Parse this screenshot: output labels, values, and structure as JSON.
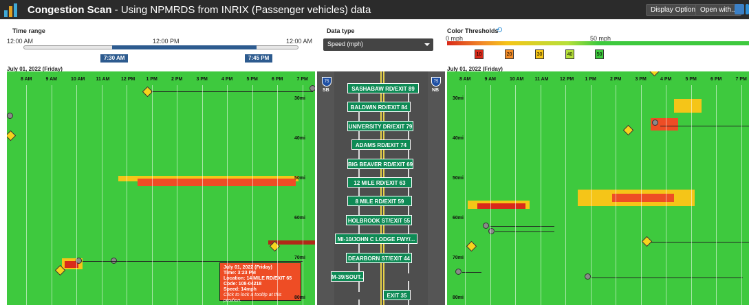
{
  "app": {
    "title_bold": "Congestion Scan",
    "title_rest": " - Using NPMRDS from INRIX (Passenger vehicles) data",
    "display_options": "Display Options",
    "open_with": "Open with..."
  },
  "time_range": {
    "label": "Time range",
    "left": "12:00 AM",
    "mid": "12:00 PM",
    "right": "12:00 AM",
    "start": "7:30 AM",
    "end": "7:45 PM"
  },
  "data_type": {
    "label": "Data type",
    "selected": "Speed (mph)"
  },
  "color_thresholds": {
    "label": "Color Thresholds",
    "min": "0 mph",
    "mid": "50 mph",
    "values": [
      "10",
      "20",
      "30",
      "40",
      "50"
    ],
    "colors": [
      "#d92a1a",
      "#f28c28",
      "#f5c518",
      "#b6e03a",
      "#3ec93e"
    ]
  },
  "left_panel": {
    "date": "July 01, 2022 (Friday)",
    "hours": [
      "8 AM",
      "9 AM",
      "10 AM",
      "11 AM",
      "12 PM",
      "1 PM",
      "2 PM",
      "3 PM",
      "4 PM",
      "5 PM",
      "6 PM",
      "7 PM"
    ],
    "miles": [
      "30mi",
      "40mi",
      "50mi",
      "60mi",
      "70mi",
      "80mi"
    ]
  },
  "right_panel": {
    "date": "July 01, 2022 (Friday)",
    "hours": [
      "8 AM",
      "9 AM",
      "10 AM",
      "11 AM",
      "12 PM",
      "1 PM",
      "2 PM",
      "3 PM",
      "4 PM",
      "5 PM",
      "6 PM",
      "7 PM"
    ],
    "miles": [
      "30mi",
      "40mi",
      "50mi",
      "60mi",
      "70mi",
      "80mi"
    ]
  },
  "tooltip": {
    "date": "July 01, 2022 (Friday)",
    "time": "Time: 3:23 PM",
    "location": "Location: 14 MILE RD/EXIT 65",
    "code": "Code: 108-04218",
    "speed": "Speed: 14mph",
    "hint": "Click to lock a tooltip at this position."
  },
  "road": {
    "route": "75",
    "sb": "SB",
    "nb": "NB",
    "exits": [
      "SASHABAW RD/EXIT 89",
      "BALDWIN RD/EXIT 84",
      "UNIVERSITY DR/EXIT 79",
      "ADAMS RD/EXIT 74",
      "BIG BEAVER RD/EXIT 69",
      "12 MILE RD/EXIT 63",
      "8 MILE RD/EXIT 59",
      "HOLBROOK ST/EXIT 55",
      "MI-10/JOHN C LODGE FWY/...",
      "DEARBORN ST/EXIT 44",
      "M-39/SOUT...",
      "EXIT 35"
    ]
  }
}
